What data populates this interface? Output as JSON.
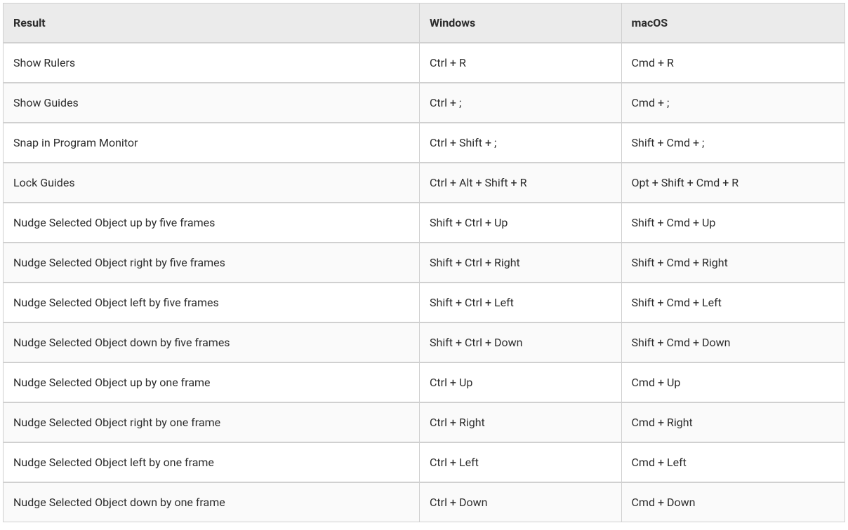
{
  "table": {
    "headers": {
      "result": "Result",
      "windows": "Windows",
      "macos": "macOS"
    },
    "rows": [
      {
        "result": "Show Rulers",
        "windows": "Ctrl + R",
        "macos": "Cmd + R"
      },
      {
        "result": "Show Guides",
        "windows": "Ctrl + ;",
        "macos": "Cmd + ;"
      },
      {
        "result": "Snap in Program Monitor",
        "windows": "Ctrl + Shift + ;",
        "macos": "Shift + Cmd + ;"
      },
      {
        "result": "Lock Guides",
        "windows": "Ctrl + Alt + Shift + R",
        "macos": "Opt + Shift + Cmd + R"
      },
      {
        "result": "Nudge Selected Object up by five frames",
        "windows": "Shift + Ctrl + Up",
        "macos": "Shift + Cmd + Up"
      },
      {
        "result": "Nudge Selected Object right by five frames",
        "windows": "Shift + Ctrl + Right",
        "macos": "Shift + Cmd + Right"
      },
      {
        "result": "Nudge Selected Object left by five frames",
        "windows": "Shift + Ctrl + Left",
        "macos": "Shift + Cmd + Left"
      },
      {
        "result": "Nudge Selected Object down by five frames",
        "windows": "Shift + Ctrl + Down",
        "macos": "Shift + Cmd + Down"
      },
      {
        "result": "Nudge Selected Object up by one frame",
        "windows": "Ctrl + Up",
        "macos": "Cmd + Up"
      },
      {
        "result": "Nudge Selected Object right by one frame",
        "windows": "Ctrl + Right",
        "macos": "Cmd + Right"
      },
      {
        "result": "Nudge Selected Object left by one frame",
        "windows": "Ctrl + Left",
        "macos": "Cmd + Left"
      },
      {
        "result": "Nudge Selected Object down by one frame",
        "windows": "Ctrl + Down",
        "macos": "Cmd + Down"
      }
    ]
  }
}
